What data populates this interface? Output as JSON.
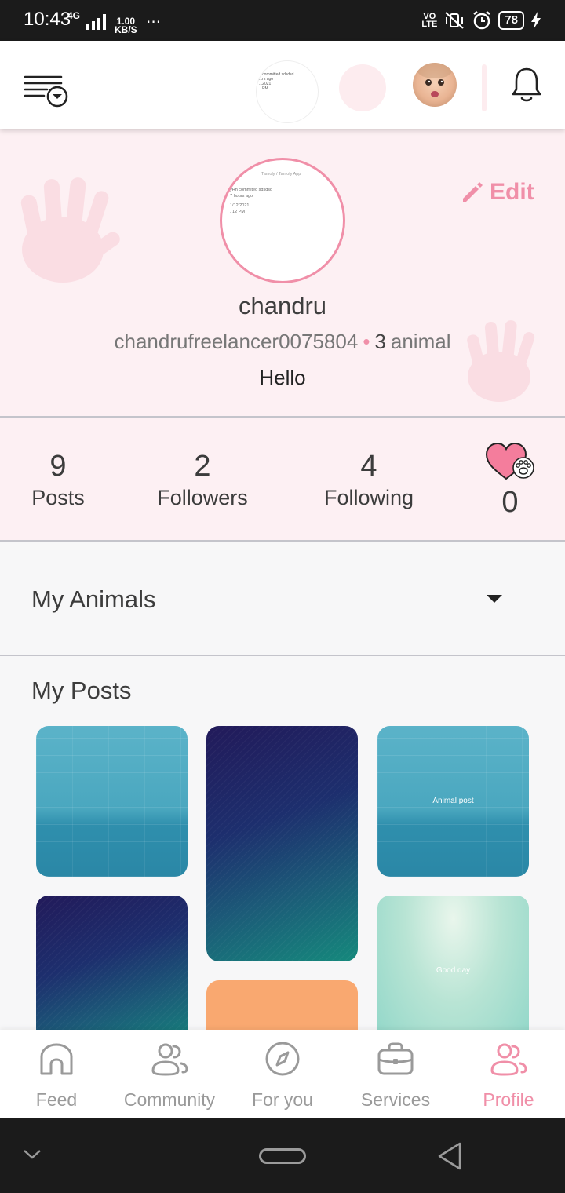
{
  "status_bar": {
    "time": "10:43",
    "network": "4G",
    "speed_value": "1.00",
    "speed_unit": "KB/S",
    "more": "···",
    "volte_1": "VO",
    "volte_2": "LTE",
    "battery": "78"
  },
  "header": {
    "story_preview_lines": [
      "...committed sdsdsd",
      "...rs ago",
      "...2021",
      "...PM"
    ]
  },
  "profile": {
    "avatar_preview": {
      "breadcrumb": "Tamoly  /  Tamoly App",
      "lines": [
        "yHh commited sdsdsd",
        "7 hours ago",
        "1/12/2021",
        ", 12 PM"
      ]
    },
    "edit_label": "Edit",
    "name": "chandru",
    "username": "chandrufreelancer0075804",
    "separator": "•",
    "animal_count": "3",
    "animal_label": "animal",
    "bio": "Hello"
  },
  "stats": {
    "posts": {
      "value": "9",
      "label": "Posts"
    },
    "followers": {
      "value": "2",
      "label": "Followers"
    },
    "following": {
      "value": "4",
      "label": "Following"
    },
    "paw_likes": {
      "value": "0"
    }
  },
  "my_animals": {
    "title": "My Animals"
  },
  "my_posts": {
    "title": "My Posts",
    "tiles": [
      {
        "caption": ""
      },
      {
        "caption": ""
      },
      {
        "caption": "Animal post"
      },
      {
        "caption": ""
      },
      {
        "caption": ""
      },
      {
        "caption": "Good day"
      }
    ]
  },
  "bottom_nav": {
    "items": [
      {
        "label": "Feed",
        "icon": "home-icon"
      },
      {
        "label": "Community",
        "icon": "community-icon"
      },
      {
        "label": "For you",
        "icon": "compass-icon"
      },
      {
        "label": "Services",
        "icon": "briefcase-icon"
      },
      {
        "label": "Profile",
        "icon": "profile-icon",
        "active": true
      }
    ]
  },
  "colors": {
    "accent": "#f08fa8",
    "profile_bg": "#fdf0f3",
    "page_bg": "#f7f7f8",
    "inactive_icon": "#9a9a9a"
  }
}
